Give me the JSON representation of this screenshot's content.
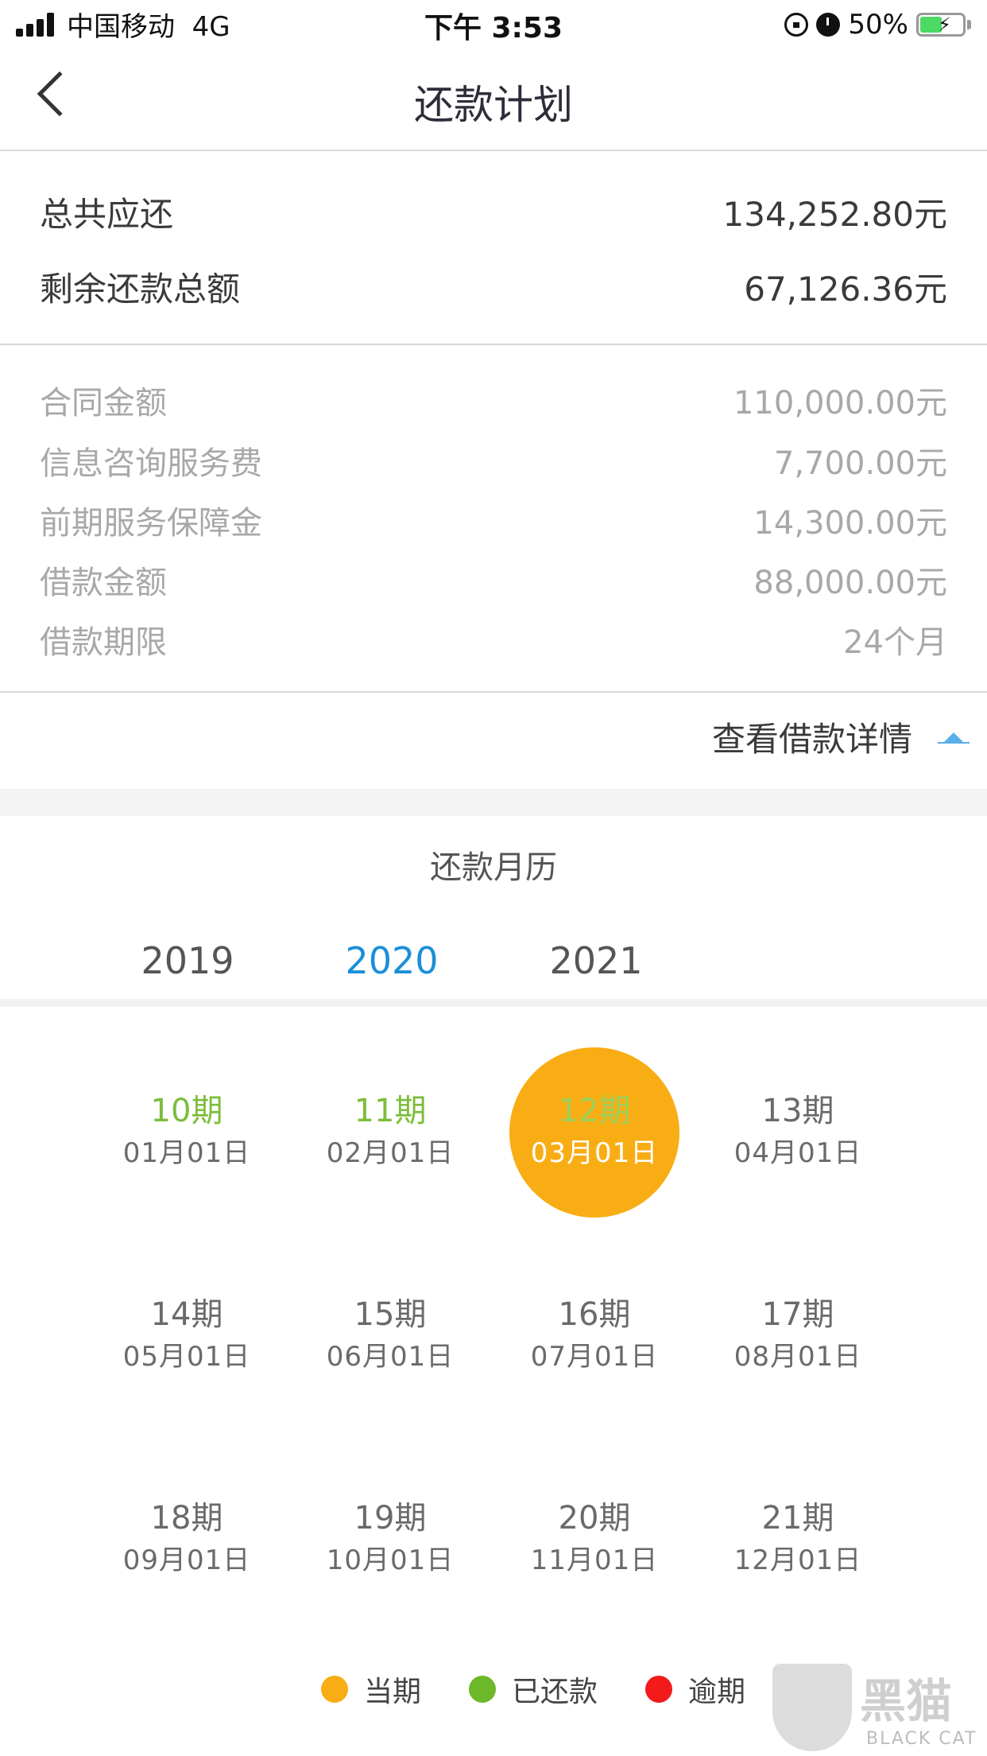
{
  "status_bar": {
    "carrier": "中国移动",
    "network": "4G",
    "time": "下午 3:53",
    "battery_pct": "50%",
    "battery_level": 0.5
  },
  "nav": {
    "title": "还款计划"
  },
  "summary": {
    "total_due_label": "总共应还",
    "total_due_value": "134,252.80元",
    "remaining_label": "剩余还款总额",
    "remaining_value": "67,126.36元"
  },
  "details": [
    {
      "label": "合同金额",
      "value": "110,000.00元"
    },
    {
      "label": "信息咨询服务费",
      "value": "7,700.00元"
    },
    {
      "label": "前期服务保障金",
      "value": "14,300.00元"
    },
    {
      "label": "借款金额",
      "value": "88,000.00元"
    },
    {
      "label": "借款期限",
      "value": "24个月"
    }
  ],
  "detail_link": "查看借款详情",
  "calendar": {
    "title": "还款月历",
    "years": [
      "2019",
      "2020",
      "2021"
    ],
    "active_year": "2020",
    "periods": [
      {
        "period": "10期",
        "date": "01月01日",
        "status": "paid"
      },
      {
        "period": "11期",
        "date": "02月01日",
        "status": "paid"
      },
      {
        "period": "12期",
        "date": "03月01日",
        "status": "current"
      },
      {
        "period": "13期",
        "date": "04月01日",
        "status": "upcoming"
      },
      {
        "period": "14期",
        "date": "05月01日",
        "status": "upcoming"
      },
      {
        "period": "15期",
        "date": "06月01日",
        "status": "upcoming"
      },
      {
        "period": "16期",
        "date": "07月01日",
        "status": "upcoming"
      },
      {
        "period": "17期",
        "date": "08月01日",
        "status": "upcoming"
      },
      {
        "period": "18期",
        "date": "09月01日",
        "status": "upcoming"
      },
      {
        "period": "19期",
        "date": "10月01日",
        "status": "upcoming"
      },
      {
        "period": "20期",
        "date": "11月01日",
        "status": "upcoming"
      },
      {
        "period": "21期",
        "date": "12月01日",
        "status": "upcoming"
      }
    ]
  },
  "legend": [
    {
      "label": "当期",
      "color": "#f9ad14"
    },
    {
      "label": "已还款",
      "color": "#6cb82a"
    },
    {
      "label": "逾期",
      "color": "#f21a1a"
    }
  ],
  "watermark": {
    "text": "黑猫",
    "sub": "BLACK CAT"
  }
}
